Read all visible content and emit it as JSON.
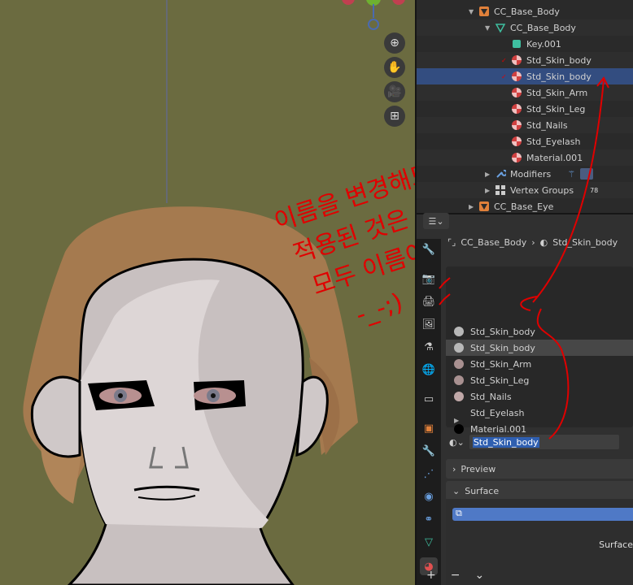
{
  "viewport": {
    "nav_buttons": [
      {
        "icon": "zoom-icon",
        "glyph": "⊕"
      },
      {
        "icon": "hand-pan-icon",
        "glyph": "✋"
      },
      {
        "icon": "camera-icon",
        "glyph": "🎥"
      },
      {
        "icon": "grid-icon",
        "glyph": "⊞"
      }
    ],
    "annotation": {
      "line1": "이름을 변경해도",
      "line2": "적용된 것은",
      "line3": "모두 이름이 바뀐다.",
      "line4": "-_-;)"
    }
  },
  "outliner": {
    "rows": [
      {
        "label": "CC_Base_Body",
        "icon": "object-icon",
        "expanded": true
      },
      {
        "label": "CC_Base_Body",
        "icon": "mesh-data-icon",
        "expanded": true
      },
      {
        "label": "Key.001",
        "icon": "shape-key-icon"
      },
      {
        "label": "Std_Skin_body",
        "icon": "material-icon",
        "checked": true
      },
      {
        "label": "Std_Skin_body",
        "icon": "material-icon",
        "checked": true
      },
      {
        "label": "Std_Skin_Arm",
        "icon": "material-icon"
      },
      {
        "label": "Std_Skin_Leg",
        "icon": "material-icon"
      },
      {
        "label": "Std_Nails",
        "icon": "material-icon"
      },
      {
        "label": "Std_Eyelash",
        "icon": "material-icon"
      },
      {
        "label": "Material.001",
        "icon": "material-icon"
      },
      {
        "label": "Modifiers",
        "icon": "wrench-icon",
        "collapsed": true
      },
      {
        "label": "Vertex Groups",
        "icon": "vertex-groups-icon",
        "collapsed": true,
        "count": "78"
      },
      {
        "label": "CC_Base_Eye",
        "icon": "object-icon",
        "collapsed": true
      }
    ]
  },
  "properties": {
    "breadcrumb": {
      "object": "CC_Base_Body",
      "material": "Std_Skin_body"
    },
    "slots": [
      {
        "label": "Std_Skin_body",
        "color": "#b8b8b8"
      },
      {
        "label": "Std_Skin_body",
        "color": "#b8b8b8",
        "active": true
      },
      {
        "label": "Std_Skin_Arm",
        "color": "#a89090"
      },
      {
        "label": "Std_Skin_Leg",
        "color": "#a89090"
      },
      {
        "label": "Std_Nails",
        "color": "#c0a8a8"
      },
      {
        "label": "Std_Eyelash",
        "color": "none"
      },
      {
        "label": "Material.001",
        "color": "#000000"
      }
    ],
    "material_name": "Std_Skin_body",
    "panels": {
      "preview": "Preview",
      "surface": "Surface"
    },
    "surface_side_label": "Surface",
    "bottom_tools": {
      "add": "+",
      "remove": "−",
      "more": "⌄"
    }
  }
}
